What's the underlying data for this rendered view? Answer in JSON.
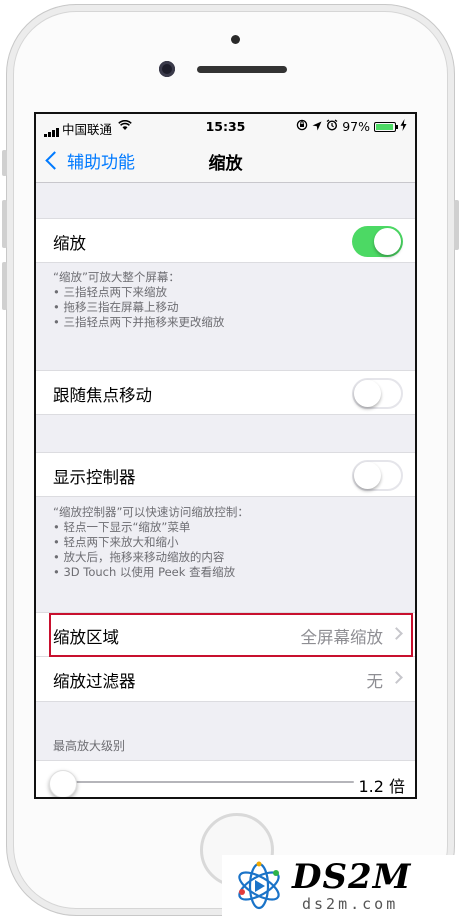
{
  "status_bar": {
    "carrier": "中国联通",
    "time": "15:35",
    "battery_percent": "97%",
    "icons": [
      "signal-icon",
      "wifi-icon",
      "orientation-lock-icon",
      "location-icon",
      "alarm-icon",
      "battery-icon",
      "charging-icon"
    ]
  },
  "nav": {
    "back_label": "辅助功能",
    "title": "缩放"
  },
  "zoom": {
    "label": "缩放",
    "enabled": true,
    "notes": [
      "“缩放”可放大整个屏幕：",
      "• 三指轻点两下来缩放",
      "• 拖移三指在屏幕上移动",
      "• 三指轻点两下并拖移来更改缩放"
    ]
  },
  "follow_focus": {
    "label": "跟随焦点移动",
    "enabled": false
  },
  "controller": {
    "label": "显示控制器",
    "enabled": false,
    "notes": [
      "“缩放控制器”可以快速访问缩放控制：",
      "• 轻点一下显示“缩放”菜单",
      "• 轻点两下来放大和缩小",
      "• 放大后，拖移来移动缩放的内容",
      "• 3D Touch 以使用 Peek 查看缩放"
    ]
  },
  "zoom_region": {
    "label": "缩放区域",
    "value": "全屏幕缩放"
  },
  "zoom_filter": {
    "label": "缩放过滤器",
    "value": "无"
  },
  "max_zoom": {
    "header": "最高放大级别",
    "value": "1.2 倍",
    "slider_fraction": 0.0
  },
  "colors": {
    "accent": "#007aff",
    "toggle_on": "#4cd964",
    "highlight": "#c8102e"
  },
  "watermark": {
    "brand": "DS2M",
    "url": "ds2m.com"
  }
}
